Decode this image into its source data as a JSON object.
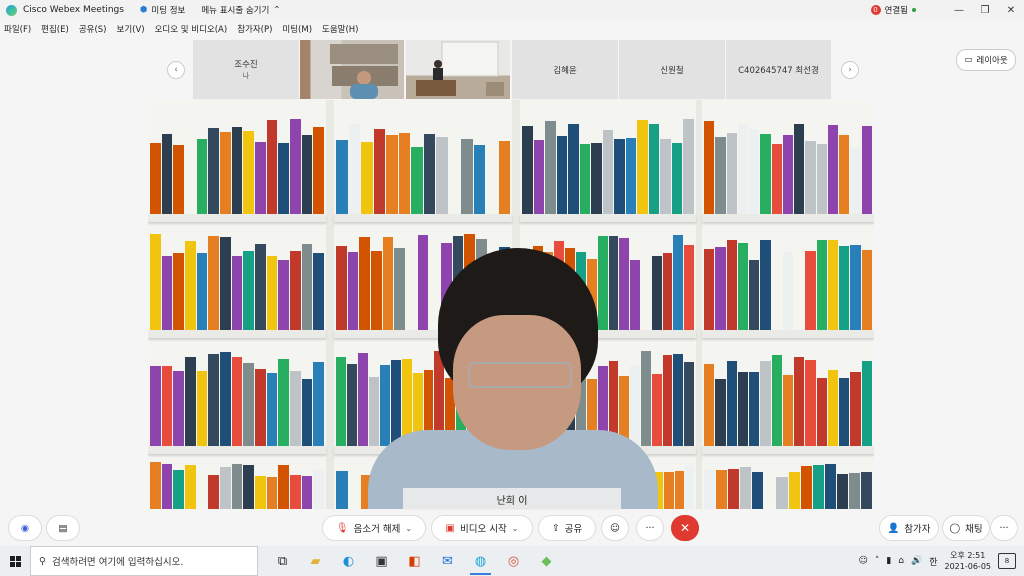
{
  "window": {
    "app_title": "Cisco Webex Meetings",
    "meeting_info": "미팅 정보",
    "hide_menu": "메뉴 표시줄 숨기기",
    "connection_badge": "0",
    "connection_status": "연결됨"
  },
  "menu": [
    "파일(F)",
    "편집(E)",
    "공유(S)",
    "보기(V)",
    "오디오 및 비디오(A)",
    "참가자(P)",
    "미팅(M)",
    "도움말(H)"
  ],
  "participants": [
    {
      "name": "조수진",
      "sub": "나"
    },
    {
      "name": "김혜윤"
    },
    {
      "name": "신원철"
    },
    {
      "name": "C402645747 최선경"
    }
  ],
  "layout_button": "레이아웃",
  "active_speaker": "난희 이",
  "controls": {
    "unmute": "음소거 해제",
    "start_video": "비디오 시작",
    "share": "공유",
    "participants": "참가자",
    "chat": "채팅"
  },
  "taskbar": {
    "search_placeholder": "검색하려면 여기에 입력하십시오.",
    "ime": "한",
    "time": "오후 2:51",
    "date": "2021-06-05",
    "notification_count": "8"
  }
}
